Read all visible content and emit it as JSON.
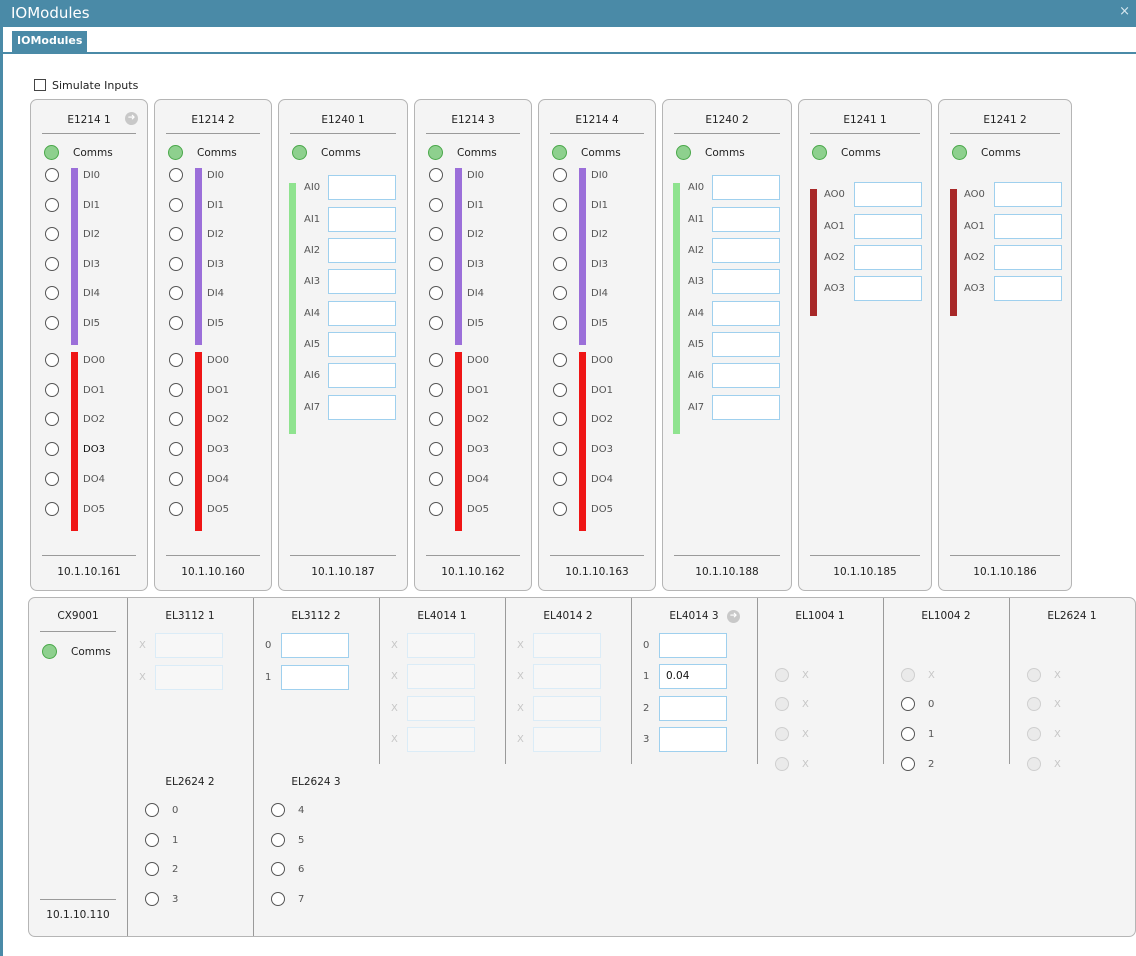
{
  "window": {
    "title": "IOModules",
    "close": "×"
  },
  "tab": {
    "label": "IOModules"
  },
  "simulate": {
    "label": "Simulate Inputs"
  },
  "comms_label": "Comms",
  "colors": {
    "purple": "#9b6fd9",
    "red": "#ef1515",
    "green": "#8fe38f",
    "darkred": "#a82828"
  },
  "modules": [
    {
      "name": "E1214 1",
      "ip": "10.1.10.161"
    },
    {
      "name": "E1214 2",
      "ip": "10.1.10.160"
    },
    {
      "name": "E1240 1",
      "ip": "10.1.10.187"
    },
    {
      "name": "E1214 3",
      "ip": "10.1.10.162"
    },
    {
      "name": "E1214 4",
      "ip": "10.1.10.163"
    },
    {
      "name": "E1240 2",
      "ip": "10.1.10.188"
    },
    {
      "name": "E1241 1",
      "ip": "10.1.10.185"
    },
    {
      "name": "E1241 2",
      "ip": "10.1.10.186"
    }
  ],
  "di_labels": [
    "DI0",
    "DI1",
    "DI2",
    "DI3",
    "DI4",
    "DI5"
  ],
  "do_labels": [
    "DO0",
    "DO1",
    "DO2",
    "DO3",
    "DO4",
    "DO5"
  ],
  "ai_labels": [
    "AI0",
    "AI1",
    "AI2",
    "AI3",
    "AI4",
    "AI5",
    "AI6",
    "AI7"
  ],
  "ao_labels": [
    "AO0",
    "AO1",
    "AO2",
    "AO3"
  ],
  "cx": {
    "name": "CX9001",
    "ip": "10.1.10.110"
  },
  "el3112_1": {
    "name": "EL3112 1",
    "rows": [
      "X",
      "X"
    ]
  },
  "el3112_2": {
    "name": "EL3112 2",
    "rows": [
      "0",
      "1"
    ]
  },
  "el4014_1": {
    "name": "EL4014 1",
    "rows": [
      "X",
      "X",
      "X",
      "X"
    ]
  },
  "el4014_2": {
    "name": "EL4014 2",
    "rows": [
      "X",
      "X",
      "X",
      "X"
    ]
  },
  "el4014_3": {
    "name": "EL4014 3",
    "rows": [
      "0",
      "1",
      "2",
      "3"
    ],
    "values": [
      "",
      "0.04",
      "",
      ""
    ]
  },
  "el1004_1": {
    "name": "EL1004 1",
    "rows": [
      "X",
      "X",
      "X",
      "X"
    ]
  },
  "el1004_2": {
    "name": "EL1004 2",
    "rows": [
      "X",
      "0",
      "1",
      "2"
    ]
  },
  "el2624_1": {
    "name": "EL2624 1",
    "rows": [
      "X",
      "X",
      "X",
      "X"
    ]
  },
  "el2624_2": {
    "name": "EL2624 2",
    "rows": [
      "0",
      "1",
      "2",
      "3"
    ]
  },
  "el2624_3": {
    "name": "EL2624 3",
    "rows": [
      "4",
      "5",
      "6",
      "7"
    ]
  }
}
